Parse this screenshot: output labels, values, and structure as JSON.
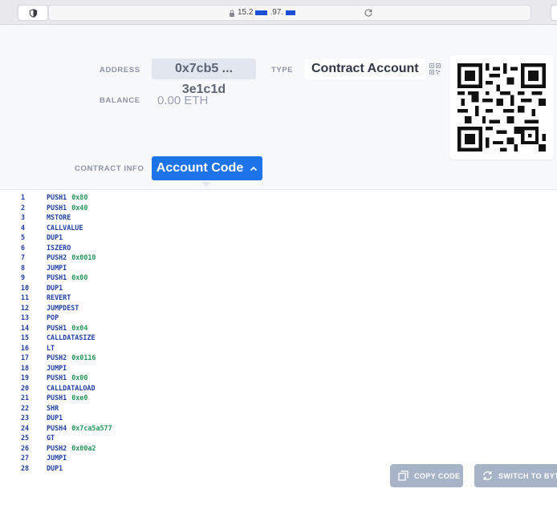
{
  "browser": {
    "url_prefix": "15.2",
    "url_middle": ".97.",
    "url_suffix": ""
  },
  "account": {
    "address_label": "ADDRESS",
    "address_value": "0x7cb5 ... 3e1c1d",
    "type_label": "TYPE",
    "type_value": "Contract Account",
    "balance_label": "BALANCE",
    "balance_value": "0.00 ETH",
    "contract_info_label": "CONTRACT INFO",
    "account_code_button": "Account Code"
  },
  "code_lines": [
    {
      "n": "1",
      "op": "PUSH1",
      "arg": "0x80"
    },
    {
      "n": "2",
      "op": "PUSH1",
      "arg": "0x40"
    },
    {
      "n": "3",
      "op": "MSTORE",
      "arg": ""
    },
    {
      "n": "4",
      "op": "CALLVALUE",
      "arg": ""
    },
    {
      "n": "5",
      "op": "DUP1",
      "arg": ""
    },
    {
      "n": "6",
      "op": "ISZERO",
      "arg": ""
    },
    {
      "n": "7",
      "op": "PUSH2",
      "arg": "0x0010"
    },
    {
      "n": "8",
      "op": "JUMPI",
      "arg": ""
    },
    {
      "n": "9",
      "op": "PUSH1",
      "arg": "0x00"
    },
    {
      "n": "10",
      "op": "DUP1",
      "arg": ""
    },
    {
      "n": "11",
      "op": "REVERT",
      "arg": ""
    },
    {
      "n": "12",
      "op": "JUMPDEST",
      "arg": ""
    },
    {
      "n": "13",
      "op": "POP",
      "arg": ""
    },
    {
      "n": "14",
      "op": "PUSH1",
      "arg": "0x04"
    },
    {
      "n": "15",
      "op": "CALLDATASIZE",
      "arg": ""
    },
    {
      "n": "16",
      "op": "LT",
      "arg": ""
    },
    {
      "n": "17",
      "op": "PUSH2",
      "arg": "0x0116"
    },
    {
      "n": "18",
      "op": "JUMPI",
      "arg": ""
    },
    {
      "n": "19",
      "op": "PUSH1",
      "arg": "0x00"
    },
    {
      "n": "20",
      "op": "CALLDATALOAD",
      "arg": ""
    },
    {
      "n": "21",
      "op": "PUSH1",
      "arg": "0xe0"
    },
    {
      "n": "22",
      "op": "SHR",
      "arg": ""
    },
    {
      "n": "23",
      "op": "DUP1",
      "arg": ""
    },
    {
      "n": "24",
      "op": "PUSH4",
      "arg": "0x7ca5a577"
    },
    {
      "n": "25",
      "op": "GT",
      "arg": ""
    },
    {
      "n": "26",
      "op": "PUSH2",
      "arg": "0x00a2"
    },
    {
      "n": "27",
      "op": "JUMPI",
      "arg": ""
    },
    {
      "n": "28",
      "op": "DUP1",
      "arg": ""
    }
  ],
  "actions": {
    "copy_code": "COPY CODE",
    "switch_to_bytecode": "SWITCH TO BYTE"
  },
  "colors": {
    "accent": "#1d73e8",
    "opcode": "#1f3fa3",
    "argument": "#27955b",
    "float_button": "#a7b4c8"
  }
}
